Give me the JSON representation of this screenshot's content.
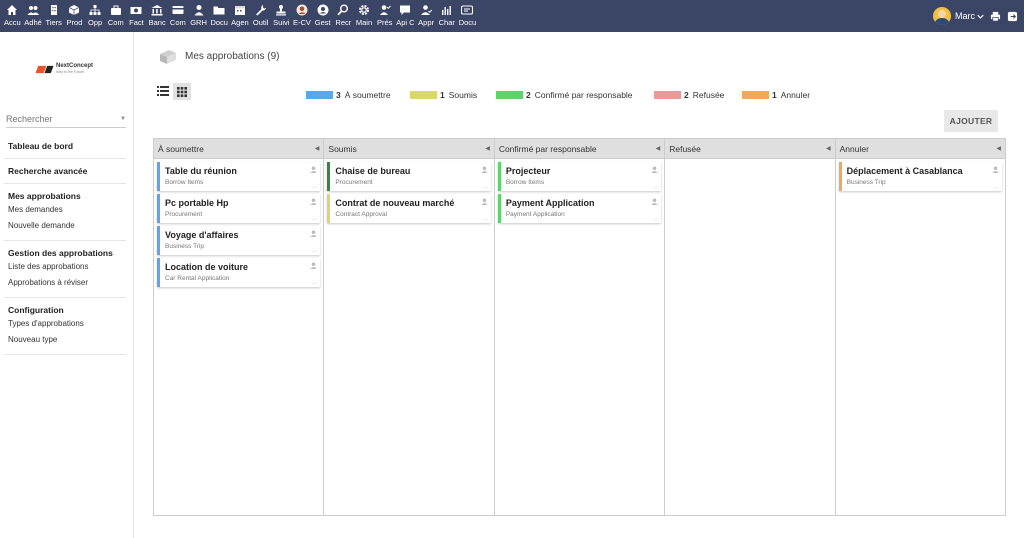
{
  "colors": {
    "topbar": "#3b4566",
    "a_soumettre": "#5aa7ee",
    "soumis": "#d9d86a",
    "confirme": "#5bd46c",
    "refusee": "#e89a9a",
    "annuler": "#f2a85a",
    "soumis_card_green": "#2e8b3a"
  },
  "topmenu": [
    {
      "label": "Accu",
      "icon": "home-icon"
    },
    {
      "label": "Adhé",
      "icon": "users-icon"
    },
    {
      "label": "Tiers",
      "icon": "building-icon"
    },
    {
      "label": "Prod",
      "icon": "cube-icon"
    },
    {
      "label": "Opp",
      "icon": "sitemap-icon"
    },
    {
      "label": "Com",
      "icon": "briefcase-icon"
    },
    {
      "label": "Fact",
      "icon": "money-icon"
    },
    {
      "label": "Banc",
      "icon": "bank-icon"
    },
    {
      "label": "Com",
      "icon": "card-icon"
    },
    {
      "label": "GRH",
      "icon": "person-icon"
    },
    {
      "label": "Docu",
      "icon": "folder-icon"
    },
    {
      "label": "Agen",
      "icon": "calendar-icon"
    },
    {
      "label": "Outil",
      "icon": "wrench-icon"
    },
    {
      "label": "Suivi",
      "icon": "stamp-icon"
    },
    {
      "label": "E-CV",
      "icon": "profile-icon"
    },
    {
      "label": "Gest",
      "icon": "support-icon"
    },
    {
      "label": "Recr",
      "icon": "search-person-icon"
    },
    {
      "label": "Main",
      "icon": "gear-icon"
    },
    {
      "label": "Prés",
      "icon": "presence-icon"
    },
    {
      "label": "Api C",
      "icon": "chat-icon"
    },
    {
      "label": "Appr",
      "icon": "approval-icon"
    },
    {
      "label": "Char",
      "icon": "chart-icon"
    },
    {
      "label": "Docu",
      "icon": "grid-doc-icon"
    }
  ],
  "user": {
    "name": "Marc"
  },
  "sidebar": {
    "search_placeholder": "Rechercher",
    "sections": [
      {
        "title": "Tableau de bord",
        "items": []
      },
      {
        "title": "Recherche avancée",
        "items": []
      },
      {
        "title": "Mes approbations",
        "items": [
          "Mes demandes",
          "Nouvelle demande"
        ]
      },
      {
        "title": "Gestion des approbations",
        "items": [
          "Liste des approbations",
          "Approbations à réviser"
        ]
      },
      {
        "title": "Configuration",
        "items": [
          "Types d'approbations",
          "Nouveau type"
        ]
      }
    ]
  },
  "page": {
    "title": "Mes approbations (9)"
  },
  "legend": [
    {
      "count": "3",
      "label": "À soumettre",
      "color": "#5aa7ee"
    },
    {
      "count": "1",
      "label": "Soumis",
      "color": "#d9d86a"
    },
    {
      "count": "2",
      "label": "Confirmé par responsable",
      "color": "#5bd46c"
    },
    {
      "count": "2",
      "label": "Refusée",
      "color": "#e89a9a"
    },
    {
      "count": "1",
      "label": "Annuler",
      "color": "#f2a85a"
    }
  ],
  "add_button": "AJOUTER",
  "columns": [
    {
      "title": "À soumettre",
      "cards": [
        {
          "title": "Table du réunion",
          "type": "Borrow Items",
          "color": "#5aa7ee"
        },
        {
          "title": "Pc portable Hp",
          "type": "Procurement",
          "color": "#5aa7ee"
        },
        {
          "title": "Voyage d'affaires",
          "type": "Business Trip",
          "color": "#5aa7ee"
        },
        {
          "title": "Location de voiture",
          "type": "Car Rental Application",
          "color": "#5aa7ee"
        }
      ]
    },
    {
      "title": "Soumis",
      "cards": [
        {
          "title": "Chaise de bureau",
          "type": "Procurement",
          "color": "#2e8b3a"
        },
        {
          "title": "Contrat de nouveau marché",
          "type": "Contract Approval",
          "color": "#d9d86a"
        }
      ]
    },
    {
      "title": "Confirmé par responsable",
      "cards": [
        {
          "title": "Projecteur",
          "type": "Borrow Items",
          "color": "#5bd46c"
        },
        {
          "title": "Payment Application",
          "type": "Payment Application",
          "color": "#5bd46c"
        }
      ]
    },
    {
      "title": "Refusée",
      "cards": []
    },
    {
      "title": "Annuler",
      "cards": [
        {
          "title": "Déplacement à Casablanca",
          "type": "Business Trip",
          "color": "#f2a85a"
        }
      ]
    }
  ]
}
